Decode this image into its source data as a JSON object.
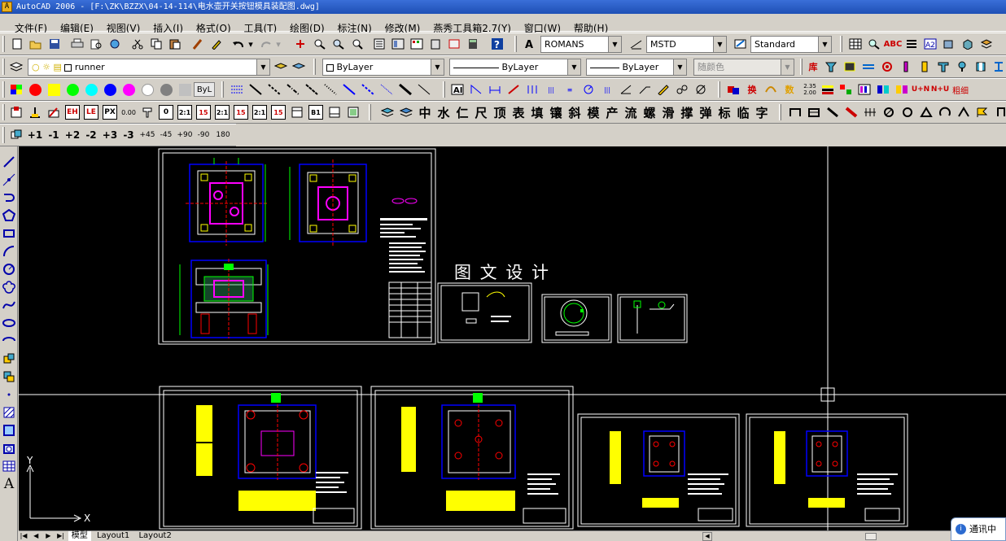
{
  "window": {
    "title": "AutoCAD 2006 - [F:\\ZK\\BZZX\\04-14-114\\电水壶开关按钮模具装配图.dwg]",
    "app_icon": "autocad-logo-icon"
  },
  "menu": [
    "文件(F)",
    "编辑(E)",
    "视图(V)",
    "插入(I)",
    "格式(O)",
    "工具(T)",
    "绘图(D)",
    "标注(N)",
    "修改(M)",
    "燕秀工具箱2.7(Y)",
    "窗口(W)",
    "帮助(H)"
  ],
  "toolbar1": {
    "text_style": "ROMANS",
    "dim_style": "MSTD",
    "table_style": "Standard"
  },
  "toolbar2": {
    "layer": "runner",
    "color": "ByLayer",
    "linetype": "ByLayer",
    "lineweight": "ByLayer",
    "plot_style": "随颜色"
  },
  "toolbar3": {
    "colors": [
      "#ff0000",
      "#ffff00",
      "#00ff00",
      "#00ffff",
      "#0000ff",
      "#ff00ff",
      "#ffffff",
      "#808080",
      "#c0c0c0"
    ],
    "bylayer_label": "ByL",
    "swap_label": "换",
    "num_label": "数",
    "dims_label": "2.35 2.00",
    "un_label": "U+N",
    "nu_label": "N+U",
    "thick_label": "粗细"
  },
  "toolbar4": {
    "mold_chars": [
      "中",
      "水",
      "仁",
      "尺",
      "顶",
      "表",
      "填",
      "镶",
      "斜",
      "模",
      "产",
      "流",
      "螺",
      "滑",
      "撑",
      "弹",
      "标",
      "临",
      "字"
    ]
  },
  "toolbar5": {
    "rotate_labels": [
      "+1",
      "-1",
      "+2",
      "-2",
      "+3",
      "-3",
      "+45",
      "-45",
      "+90",
      "-90",
      "180"
    ]
  },
  "canvas": {
    "watermark": "图 文 设 计",
    "ucs_x": "X",
    "ucs_y": "Y"
  },
  "tabs": [
    "模型",
    "Layout1",
    "Layout2"
  ],
  "notice": "通讯中"
}
